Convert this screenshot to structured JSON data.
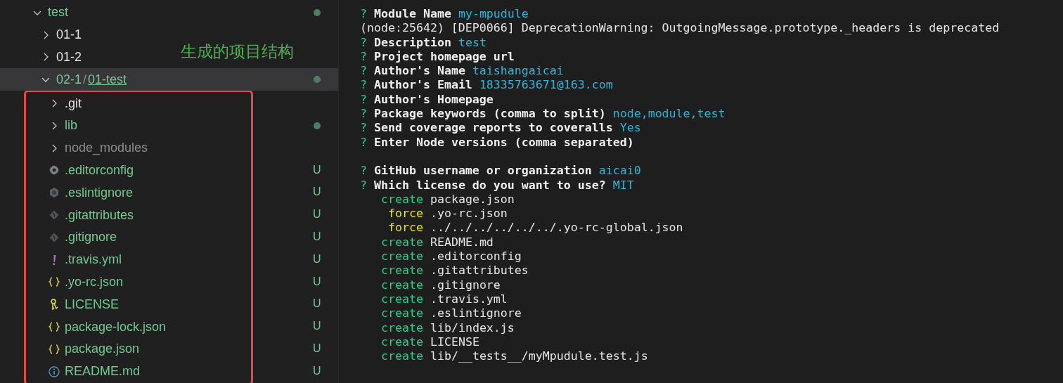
{
  "explorer": {
    "annotation": "生成的项目结构",
    "tree": [
      {
        "label": "test",
        "kind": "folder",
        "expanded": true,
        "selected": false,
        "untracked": true,
        "ignored": false,
        "has_changes": true,
        "children": [
          {
            "label": "01-1",
            "kind": "folder",
            "expanded": false,
            "selected": false,
            "untracked": false,
            "ignored": false,
            "has_changes": false
          },
          {
            "label": "01-2",
            "kind": "folder",
            "expanded": false,
            "selected": false,
            "untracked": false,
            "ignored": false,
            "has_changes": false
          },
          {
            "segments": [
              "02-1",
              "01-test"
            ],
            "separator": "/",
            "kind": "folder",
            "expanded": true,
            "selected": true,
            "untracked": true,
            "ignored": false,
            "has_changes": true,
            "highlighted": true,
            "children": [
              {
                "label": ".git",
                "kind": "folder",
                "expanded": false,
                "selected": false,
                "untracked": false,
                "ignored": false,
                "has_changes": false
              },
              {
                "label": "lib",
                "kind": "folder",
                "expanded": false,
                "selected": false,
                "untracked": true,
                "ignored": false,
                "has_changes": true
              },
              {
                "label": "node_modules",
                "kind": "folder",
                "expanded": false,
                "selected": false,
                "untracked": false,
                "ignored": true,
                "has_changes": false
              },
              {
                "label": ".editorconfig",
                "kind": "config",
                "selected": false,
                "untracked": true,
                "ignored": false,
                "badge": "U"
              },
              {
                "label": ".eslintignore",
                "kind": "eslint",
                "selected": false,
                "untracked": true,
                "ignored": false,
                "badge": "U"
              },
              {
                "label": ".gitattributes",
                "kind": "git",
                "selected": false,
                "untracked": true,
                "ignored": false,
                "badge": "U"
              },
              {
                "label": ".gitignore",
                "kind": "git",
                "selected": false,
                "untracked": true,
                "ignored": false,
                "badge": "U"
              },
              {
                "label": ".travis.yml",
                "kind": "yaml",
                "selected": false,
                "untracked": true,
                "ignored": false,
                "badge": "U"
              },
              {
                "label": ".yo-rc.json",
                "kind": "json",
                "selected": false,
                "untracked": true,
                "ignored": false,
                "badge": "U"
              },
              {
                "label": "LICENSE",
                "kind": "license",
                "selected": false,
                "untracked": true,
                "ignored": false,
                "badge": "U"
              },
              {
                "label": "package-lock.json",
                "kind": "json",
                "selected": false,
                "untracked": true,
                "ignored": false,
                "badge": "U"
              },
              {
                "label": "package.json",
                "kind": "json",
                "selected": false,
                "untracked": true,
                "ignored": false,
                "badge": "U"
              },
              {
                "label": "README.md",
                "kind": "markdown",
                "selected": false,
                "untracked": true,
                "ignored": false,
                "badge": "U"
              }
            ]
          }
        ]
      }
    ]
  },
  "terminal": {
    "lines": [
      {
        "kind": "prompt",
        "marker": "?",
        "question": "Module Name",
        "answer": "my-mpudule"
      },
      {
        "kind": "plain",
        "text": "(node:25642) [DEP0066] DeprecationWarning: OutgoingMessage.prototype._headers is deprecated"
      },
      {
        "kind": "prompt",
        "marker": "?",
        "question": "Description",
        "answer": "test"
      },
      {
        "kind": "prompt",
        "marker": "?",
        "question": "Project homepage url"
      },
      {
        "kind": "prompt",
        "marker": "?",
        "question": "Author's Name",
        "answer": "taishangaicai"
      },
      {
        "kind": "prompt",
        "marker": "?",
        "question": "Author's Email",
        "answer": "18335763671@163.com"
      },
      {
        "kind": "prompt",
        "marker": "?",
        "question": "Author's Homepage"
      },
      {
        "kind": "prompt",
        "marker": "?",
        "question": "Package keywords (comma to split)",
        "answer": "node,module,test"
      },
      {
        "kind": "prompt",
        "marker": "?",
        "question": "Send coverage reports to coveralls",
        "answer": "Yes"
      },
      {
        "kind": "prompt",
        "marker": "?",
        "question": "Enter Node versions (comma separated)"
      },
      {
        "kind": "blank"
      },
      {
        "kind": "prompt",
        "marker": "?",
        "question": "GitHub username or organization",
        "answer": "aicai0"
      },
      {
        "kind": "prompt",
        "marker": "?",
        "question": "Which license do you want to use?",
        "answer": "MIT"
      },
      {
        "kind": "file",
        "action": "create",
        "path": "package.json"
      },
      {
        "kind": "file",
        "action": "force",
        "path": ".yo-rc.json"
      },
      {
        "kind": "file",
        "action": "force",
        "path": "../../../../../../.yo-rc-global.json"
      },
      {
        "kind": "file",
        "action": "create",
        "path": "README.md"
      },
      {
        "kind": "file",
        "action": "create",
        "path": ".editorconfig"
      },
      {
        "kind": "file",
        "action": "create",
        "path": ".gitattributes"
      },
      {
        "kind": "file",
        "action": "create",
        "path": ".gitignore"
      },
      {
        "kind": "file",
        "action": "create",
        "path": ".travis.yml"
      },
      {
        "kind": "file",
        "action": "create",
        "path": ".eslintignore"
      },
      {
        "kind": "file",
        "action": "create",
        "path": "lib/index.js"
      },
      {
        "kind": "file",
        "action": "create",
        "path": "LICENSE"
      },
      {
        "kind": "file",
        "action": "create",
        "path": "lib/__tests__/myMpudule.test.js"
      }
    ]
  }
}
